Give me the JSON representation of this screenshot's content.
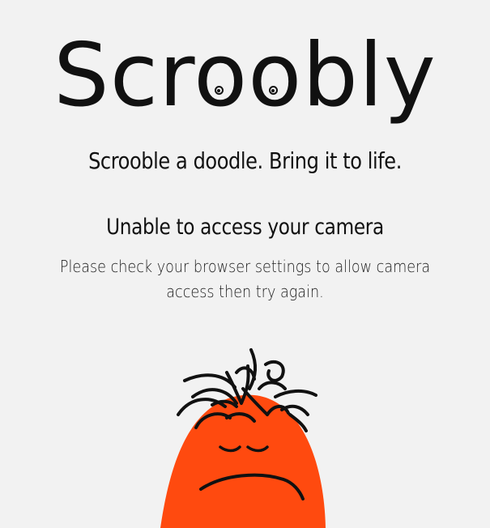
{
  "app": {
    "logo_text": "Scroobly",
    "tagline": "Scrooble a doodle. Bring it to life."
  },
  "error": {
    "title": "Unable to access your camera",
    "message": "Please check your browser settings to allow camera access then try again."
  },
  "mascot": {
    "icon": "sad-doodle-mascot-icon",
    "body_color": "#ff4a0f",
    "line_color": "#111111"
  },
  "colors": {
    "background": "#f2f2f2",
    "text": "#111111"
  }
}
